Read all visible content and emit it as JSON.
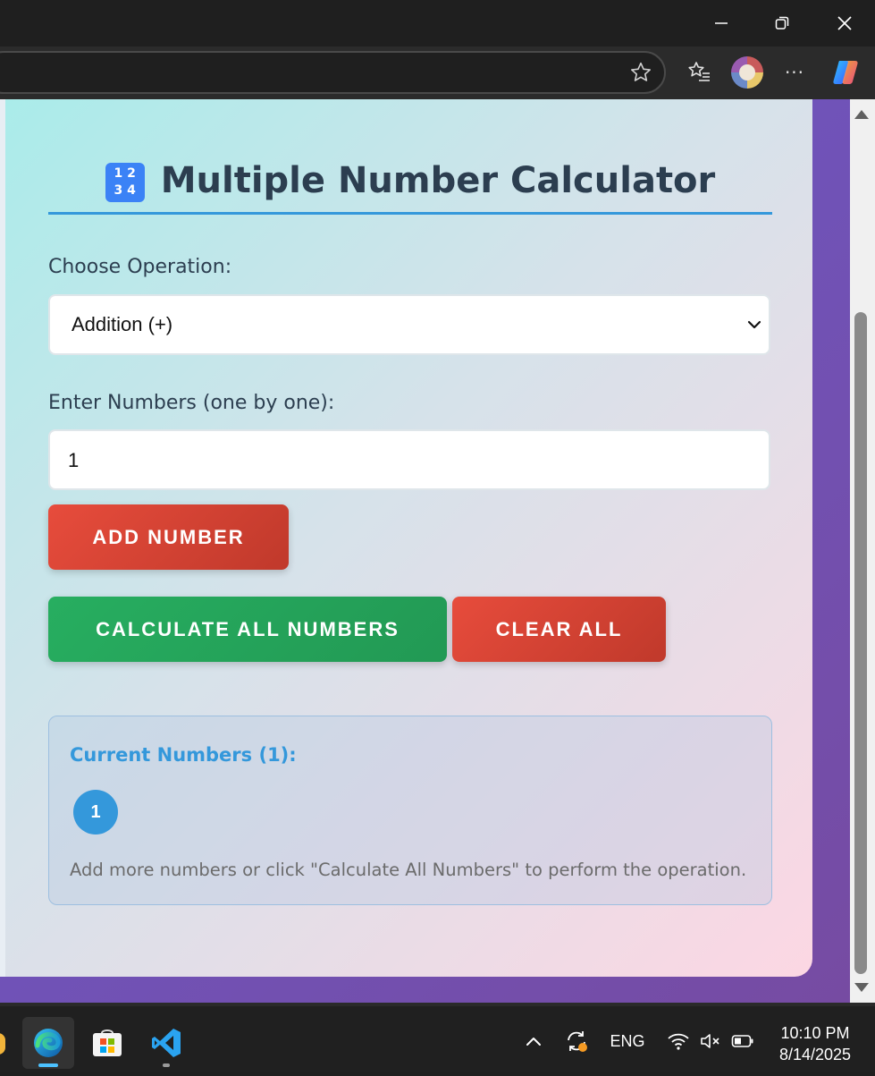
{
  "browser": {
    "more_label": "···"
  },
  "app": {
    "title_emoji": "1 2\n3 4",
    "title": "Multiple Number Calculator",
    "operation_label": "Choose Operation:",
    "operation_selected": "Addition (+)",
    "numbers_label": "Enter Numbers (one by one):",
    "number_input_value": "1",
    "add_button": "ADD NUMBER",
    "calculate_button": "CALCULATE ALL NUMBERS",
    "clear_button": "CLEAR ALL",
    "current_numbers_title": "Current Numbers (1):",
    "numbers": [
      "1"
    ],
    "hint": "Add more numbers or click \"Calculate All Numbers\" to perform the operation."
  },
  "taskbar": {
    "language": "ENG",
    "time": "10:10 PM",
    "date": "8/14/2025"
  },
  "colors": {
    "accent_blue": "#3498db",
    "red_button": "#e74c3c",
    "green_button": "#27ae60",
    "title_text": "#2c3e50"
  }
}
